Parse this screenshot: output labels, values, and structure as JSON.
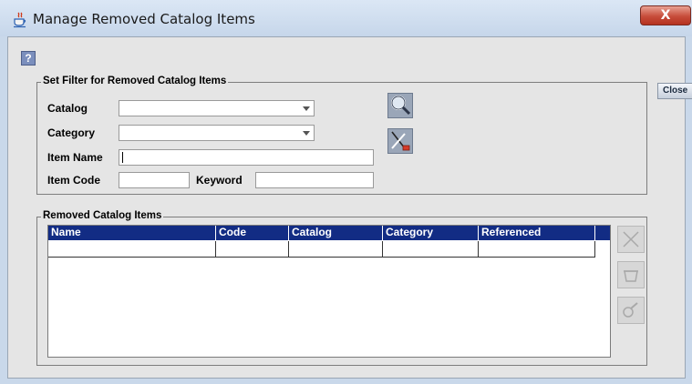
{
  "window": {
    "title": "Manage Removed Catalog Items",
    "close_glyph": "X",
    "app_icon": "java-cup-icon"
  },
  "toolbar": {
    "help_icon": "help-icon",
    "help_glyph": "?",
    "close_label": "Close"
  },
  "filter": {
    "legend": "Set Filter for Removed Catalog Items",
    "catalog_label": "Catalog",
    "catalog_value": "",
    "category_label": "Category",
    "category_value": "",
    "item_name_label": "Item Name",
    "item_name_value": "",
    "item_code_label": "Item Code",
    "item_code_value": "",
    "keyword_label": "Keyword",
    "keyword_value": "",
    "search_icon": "magnifier-icon",
    "clear_icon": "clear-filter-icon"
  },
  "results": {
    "legend": "Removed Catalog Items",
    "columns": [
      "Name",
      "Code",
      "Catalog",
      "Category",
      "Referenced"
    ],
    "rows": [
      [
        "",
        "",
        "",
        "",
        ""
      ]
    ],
    "actions": [
      "delete-icon",
      "restore-icon",
      "view-icon"
    ]
  },
  "colors": {
    "table_header": "#122c84",
    "title_close": "#c74c3a"
  }
}
